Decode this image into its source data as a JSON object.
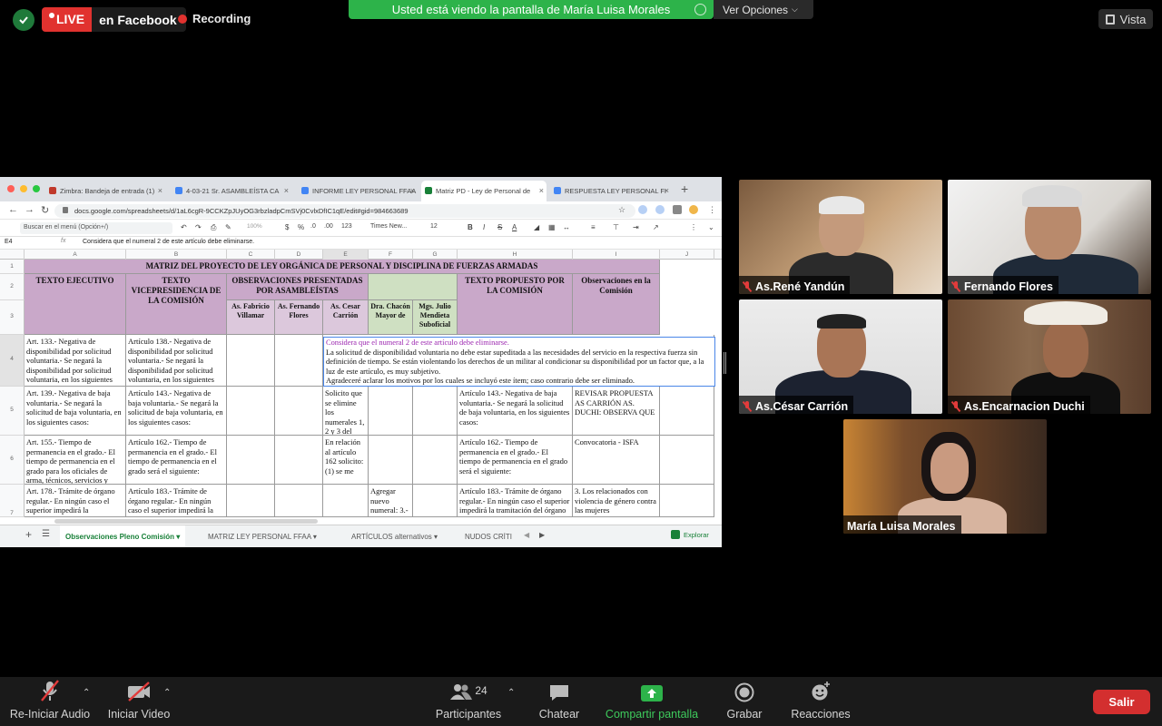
{
  "topbar": {
    "live_label": "LIVE",
    "platform_label": "en Facebook",
    "recording_label": "Recording",
    "share_banner": "Usted está viendo la pantalla de María Luisa Morales",
    "view_options": "Ver Opciones",
    "view_label": "Vista"
  },
  "browser": {
    "tabs": [
      {
        "label": "Zimbra: Bandeja de entrada (1)"
      },
      {
        "label": "4-03-21 Sr. ASAMBLEÍSTA CA"
      },
      {
        "label": "INFORME LEY PERSONAL FFAA"
      },
      {
        "label": "Matriz PD - Ley de Personal de"
      },
      {
        "label": "RESPUESTA LEY PERSONAL FI"
      }
    ],
    "url": "docs.google.com/spreadsheets/d/1aL6cgR-9CCKZpJUyOG3rbzladpCmSVj0CvlxDfIC1qE/edit#gid=984663689"
  },
  "sheets": {
    "menu_search_placeholder": "Buscar en el menú (Opción+/)",
    "zoom": "100%",
    "currency": "$",
    "percent": "%",
    "decimals_less": ".0",
    "decimals_more": ".00",
    "number_format": "123",
    "font": "Times New...",
    "font_size": "12",
    "bold": "B",
    "italic": "I",
    "strike": "S",
    "text_color": "A",
    "cell_ref": "E4",
    "formula_icon": "fx",
    "formula": "Considera que el numeral 2 de este artículo debe eliminarse.",
    "columns": [
      "A",
      "B",
      "C",
      "D",
      "E",
      "F",
      "G",
      "H",
      "I",
      "J"
    ],
    "rows": [
      "1",
      "2",
      "3",
      "4",
      "5",
      "6",
      "7"
    ],
    "title": "MATRIZ DEL PROYECTO DE LEY ORGÁNICA DE PERSONAL Y DISCIPLINA DE FUERZAS ARMADAS",
    "headers": {
      "a": "TEXTO EJECUTIVO",
      "b": "TEXTO VICEPRESIDENCIA DE LA COMISIÓN",
      "cde": "OBSERVACIONES PRESENTADAS POR ASAMBLEÍSTAS",
      "c3": "As. Fabricio Villamar",
      "d3": "As. Fernando Flores",
      "e3": "As. Cesar Carrión",
      "f3": "Dra. Chacón Mayor de",
      "g3": "Mgs. Julio Mendieta Suboficial",
      "h": "TEXTO PROPUESTO POR LA COMISIÓN",
      "i": "Observaciones en la Comisión"
    },
    "r4": {
      "a": "Art. 133.- Negativa de disponibilidad por solicitud voluntaria.- Se negará la disponibilidad por solicitud voluntaria, en los siguientes",
      "b": "Artículo 138.- Negativa de disponibilidad por solicitud voluntaria.- Se negará la disponibilidad por solicitud voluntaria, en los siguientes"
    },
    "comment": {
      "line1": "Considera que el numeral 2 de este artículo debe eliminarse.",
      "line2": "La solicitud de disponibilidad voluntaria no debe estar supeditada a las necesidades del servicio en la respectiva fuerza sin definición de tiempo. Se están violentando los derechos de un militar al condicionar su disponibilidad por un factor que, a la luz de este artículo, es muy subjetivo.",
      "line3": "Agradeceré aclarar los motivos por los cuales se incluyó este ítem; caso contrario debe ser eliminado."
    },
    "r5": {
      "a": "Art. 139.- Negativa de baja voluntaria.- Se negará la solicitud de baja voluntaria, en los siguientes casos:",
      "b": "Artículo 143.- Negativa de baja voluntaria.- Se negará la solicitud de baja voluntaria, en los siguientes casos:",
      "e": "Solicito que se elimine los numerales 1, 2 y 3 del",
      "h": "Artículo 143.- Negativa de baja voluntaria.- Se negará la solicitud de baja voluntaria, en los siguientes casos:",
      "i": "REVISAR PROPUESTA AS CARRIÓN AS. DUCHI: OBSERVA QUE"
    },
    "r6": {
      "a": "Art. 155.- Tiempo de permanencia en el grado.- El tiempo de permanencia en el grado para los oficiales de arma, técnicos, servicios y",
      "b": "Artículo 162.- Tiempo de permanencia en el grado.- El tiempo de permanencia en el grado será el siguiente:",
      "e": "En relación al artículo 162 solicito: (1) se me",
      "h": "Artículo 162.- Tiempo de permanencia en el grado.- El tiempo de permanencia en el grado será el siguiente:",
      "i": "Convocatoria - ISFA"
    },
    "r7": {
      "a": "Art. 178.- Trámite de órgano regular.- En ningún caso el superior impedirá la tramitación del órgano",
      "b": "Artículo 183.- Trámite de órgano regular.- En ningún caso el superior impedirá la tramitación del órgano",
      "f": "Agregar nuevo numeral: 3.- Por",
      "h": "Artículo 183.- Trámite de órgano regular.- En ningún caso el superior impedirá la tramitación del órgano regular",
      "i": "3. Los relacionados con violencia de género contra las mujeres"
    },
    "sheet_tabs": [
      {
        "label": "Observaciones Pleno Comisión"
      },
      {
        "label": "MATRIZ LEY PERSONAL FFAA"
      },
      {
        "label": "ARTÍCULOS alternativos"
      },
      {
        "label": "NUDOS CRÍTI"
      }
    ],
    "explorer": "Explorar"
  },
  "participants": [
    {
      "name": "As.René Yandún"
    },
    {
      "name": "Fernando Flores"
    },
    {
      "name": "As.César Carrión"
    },
    {
      "name": "As.Encarnacion Duchi"
    },
    {
      "name": "María Luisa Morales"
    }
  ],
  "bottombar": {
    "audio": "Re-Iniciar Audio",
    "video": "Iniciar Video",
    "participants": "Participantes",
    "participants_count": "24",
    "chat": "Chatear",
    "share": "Compartir pantalla",
    "record": "Grabar",
    "reactions": "Reacciones",
    "leave": "Salir"
  },
  "colors": {
    "live_red": "#e1322f",
    "share_green": "#2db34a",
    "leave_red": "#d32f2f",
    "header_purple": "#c9a8c9",
    "header_green": "#cfe0c2",
    "comment_border": "#4a86e8"
  }
}
